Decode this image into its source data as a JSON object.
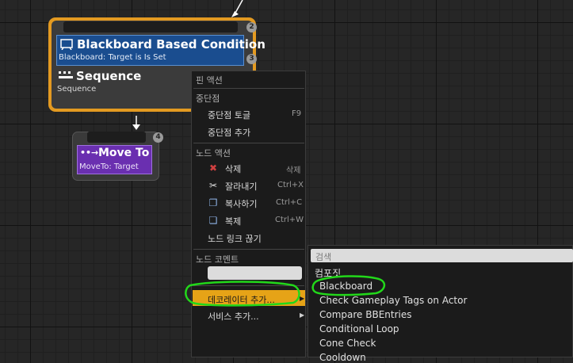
{
  "graph": {
    "condition_node": {
      "title": "Blackboard Based Condition",
      "subtitle": "Blackboard: Target is Is Set",
      "badge": "3"
    },
    "sequence_node": {
      "title": "Sequence",
      "subtitle": "Sequence",
      "badge": "2"
    },
    "moveto_node": {
      "title": "Move To",
      "subtitle": "MoveTo: Target",
      "badge": "4"
    }
  },
  "context_menu": {
    "pin_actions_header": "핀 액션",
    "breakpoint_header": "중단점",
    "toggle_breakpoint": "중단점 토글",
    "toggle_breakpoint_shortcut": "F9",
    "add_breakpoint": "중단점 추가",
    "node_actions_header": "노드 액션",
    "delete": "삭제",
    "delete_shortcut": "삭제",
    "cut": "잘라내기",
    "cut_shortcut": "Ctrl+X",
    "copy": "복사하기",
    "copy_shortcut": "Ctrl+C",
    "duplicate": "복제",
    "duplicate_shortcut": "Ctrl+W",
    "break_links": "노드 링크 끊기",
    "node_comment_header": "노드 코멘트",
    "add_decorator": "데코레이터 추가...",
    "add_service": "서비스 추가..."
  },
  "submenu": {
    "search_placeholder": "검색",
    "category": "컴포짓",
    "items": [
      "Blackboard",
      "Check Gameplay Tags on Actor",
      "Compare BBEntries",
      "Conditional Loop",
      "Cone Check",
      "Cooldown"
    ]
  },
  "colors": {
    "selection_outline": "#e39a21",
    "condition_blue": "#1a4d8f",
    "moveto_purple": "#6a2fb0",
    "highlight_orange": "#e6a317",
    "annotation_green": "#22d81a"
  }
}
